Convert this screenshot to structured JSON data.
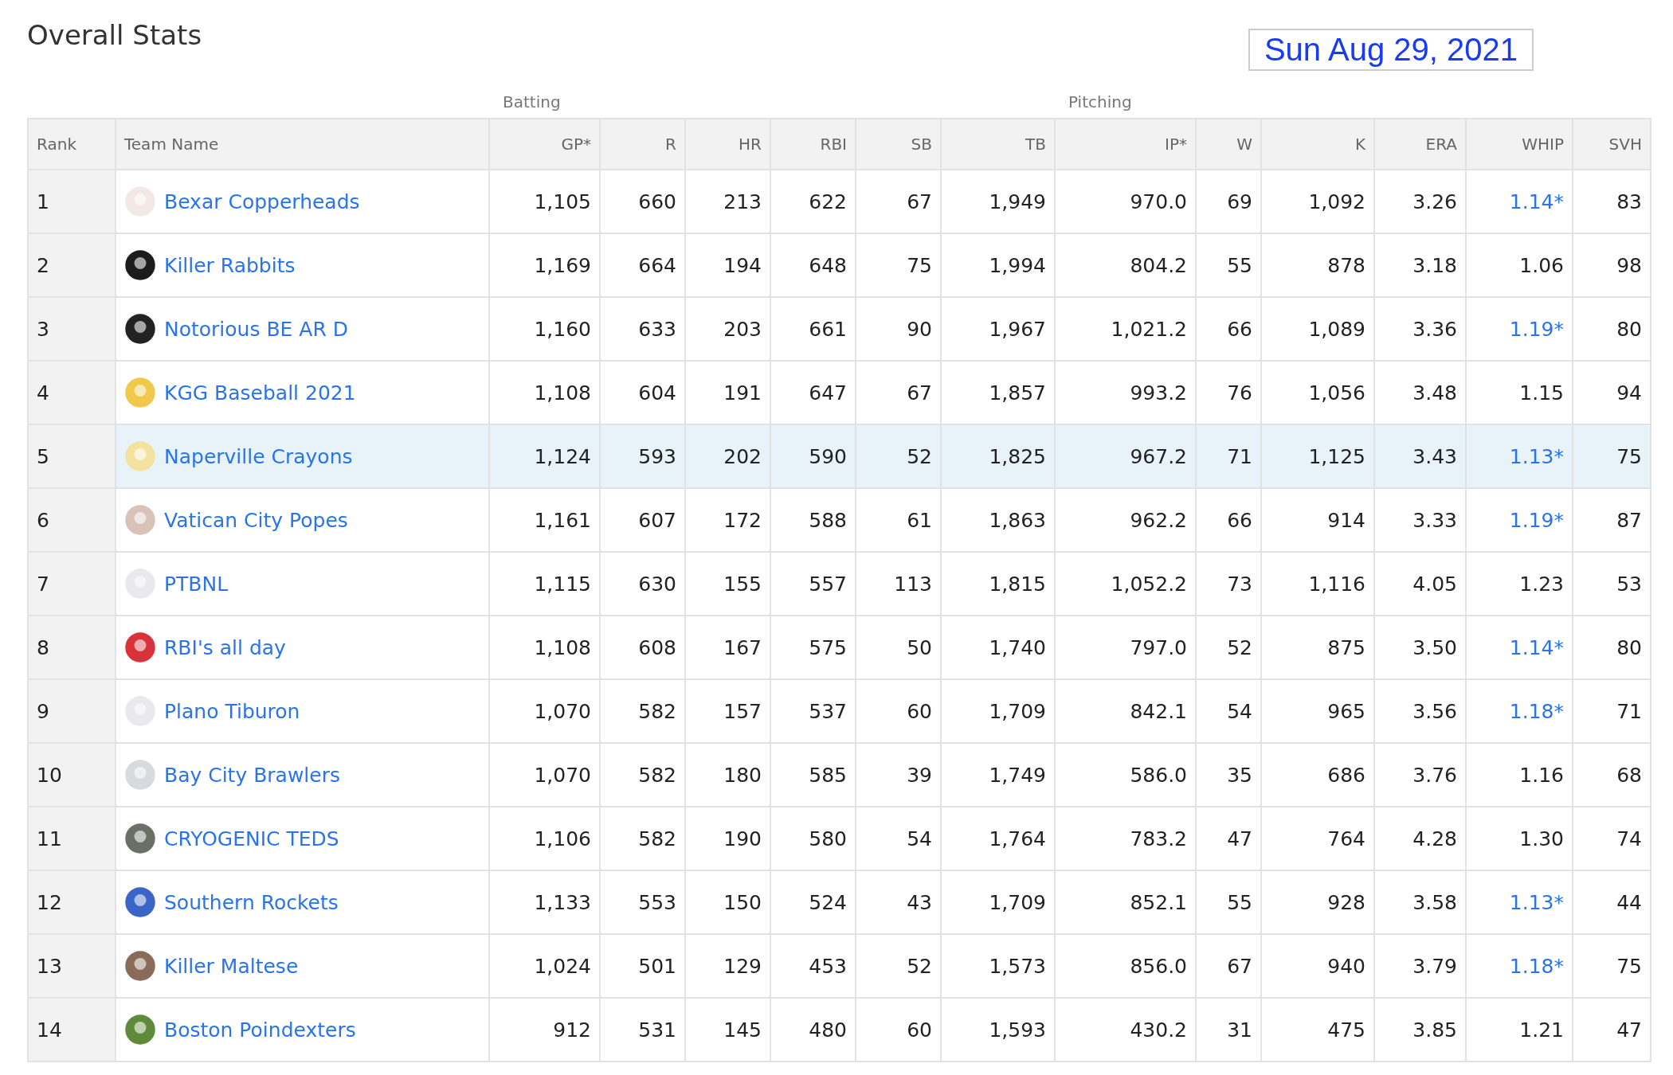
{
  "title": "Overall Stats",
  "date": "Sun Aug 29, 2021",
  "groups": [
    "Batting",
    "Pitching"
  ],
  "columns": [
    "Rank",
    "Team Name",
    "GP*",
    "R",
    "HR",
    "RBI",
    "SB",
    "TB",
    "IP*",
    "W",
    "K",
    "ERA",
    "WHIP",
    "SVH"
  ],
  "rows": [
    {
      "rank": "1",
      "team": "Bexar Copperheads",
      "selected": false,
      "whip_link": true,
      "stats": [
        "1,105",
        "660",
        "213",
        "622",
        "67",
        "1,949",
        "970.0",
        "69",
        "1,092",
        "3.26",
        "1.14*",
        "83"
      ]
    },
    {
      "rank": "2",
      "team": "Killer Rabbits",
      "selected": false,
      "whip_link": false,
      "stats": [
        "1,169",
        "664",
        "194",
        "648",
        "75",
        "1,994",
        "804.2",
        "55",
        "878",
        "3.18",
        "1.06",
        "98"
      ]
    },
    {
      "rank": "3",
      "team": "Notorious BE AR D",
      "selected": false,
      "whip_link": true,
      "stats": [
        "1,160",
        "633",
        "203",
        "661",
        "90",
        "1,967",
        "1,021.2",
        "66",
        "1,089",
        "3.36",
        "1.19*",
        "80"
      ]
    },
    {
      "rank": "4",
      "team": "KGG Baseball 2021",
      "selected": false,
      "whip_link": false,
      "stats": [
        "1,108",
        "604",
        "191",
        "647",
        "67",
        "1,857",
        "993.2",
        "76",
        "1,056",
        "3.48",
        "1.15",
        "94"
      ]
    },
    {
      "rank": "5",
      "team": "Naperville Crayons",
      "selected": true,
      "whip_link": true,
      "stats": [
        "1,124",
        "593",
        "202",
        "590",
        "52",
        "1,825",
        "967.2",
        "71",
        "1,125",
        "3.43",
        "1.13*",
        "75"
      ]
    },
    {
      "rank": "6",
      "team": "Vatican City Popes",
      "selected": false,
      "whip_link": true,
      "stats": [
        "1,161",
        "607",
        "172",
        "588",
        "61",
        "1,863",
        "962.2",
        "66",
        "914",
        "3.33",
        "1.19*",
        "87"
      ]
    },
    {
      "rank": "7",
      "team": "PTBNL",
      "selected": false,
      "whip_link": false,
      "stats": [
        "1,115",
        "630",
        "155",
        "557",
        "113",
        "1,815",
        "1,052.2",
        "73",
        "1,116",
        "4.05",
        "1.23",
        "53"
      ]
    },
    {
      "rank": "8",
      "team": "RBI's all day",
      "selected": false,
      "whip_link": true,
      "stats": [
        "1,108",
        "608",
        "167",
        "575",
        "50",
        "1,740",
        "797.0",
        "52",
        "875",
        "3.50",
        "1.14*",
        "80"
      ]
    },
    {
      "rank": "9",
      "team": "Plano Tiburon",
      "selected": false,
      "whip_link": true,
      "stats": [
        "1,070",
        "582",
        "157",
        "537",
        "60",
        "1,709",
        "842.1",
        "54",
        "965",
        "3.56",
        "1.18*",
        "71"
      ]
    },
    {
      "rank": "10",
      "team": "Bay City Brawlers",
      "selected": false,
      "whip_link": false,
      "stats": [
        "1,070",
        "582",
        "180",
        "585",
        "39",
        "1,749",
        "586.0",
        "35",
        "686",
        "3.76",
        "1.16",
        "68"
      ]
    },
    {
      "rank": "11",
      "team": "CRYOGENIC TEDS",
      "selected": false,
      "whip_link": false,
      "stats": [
        "1,106",
        "582",
        "190",
        "580",
        "54",
        "1,764",
        "783.2",
        "47",
        "764",
        "4.28",
        "1.30",
        "74"
      ]
    },
    {
      "rank": "12",
      "team": "Southern Rockets",
      "selected": false,
      "whip_link": true,
      "stats": [
        "1,133",
        "553",
        "150",
        "524",
        "43",
        "1,709",
        "852.1",
        "55",
        "928",
        "3.58",
        "1.13*",
        "44"
      ]
    },
    {
      "rank": "13",
      "team": "Killer Maltese",
      "selected": false,
      "whip_link": true,
      "stats": [
        "1,024",
        "501",
        "129",
        "453",
        "52",
        "1,573",
        "856.0",
        "67",
        "940",
        "3.79",
        "1.18*",
        "75"
      ]
    },
    {
      "rank": "14",
      "team": "Boston Poindexters",
      "selected": false,
      "whip_link": false,
      "stats": [
        "912",
        "531",
        "145",
        "480",
        "60",
        "1,593",
        "430.2",
        "31",
        "475",
        "3.85",
        "1.21",
        "47"
      ]
    }
  ]
}
